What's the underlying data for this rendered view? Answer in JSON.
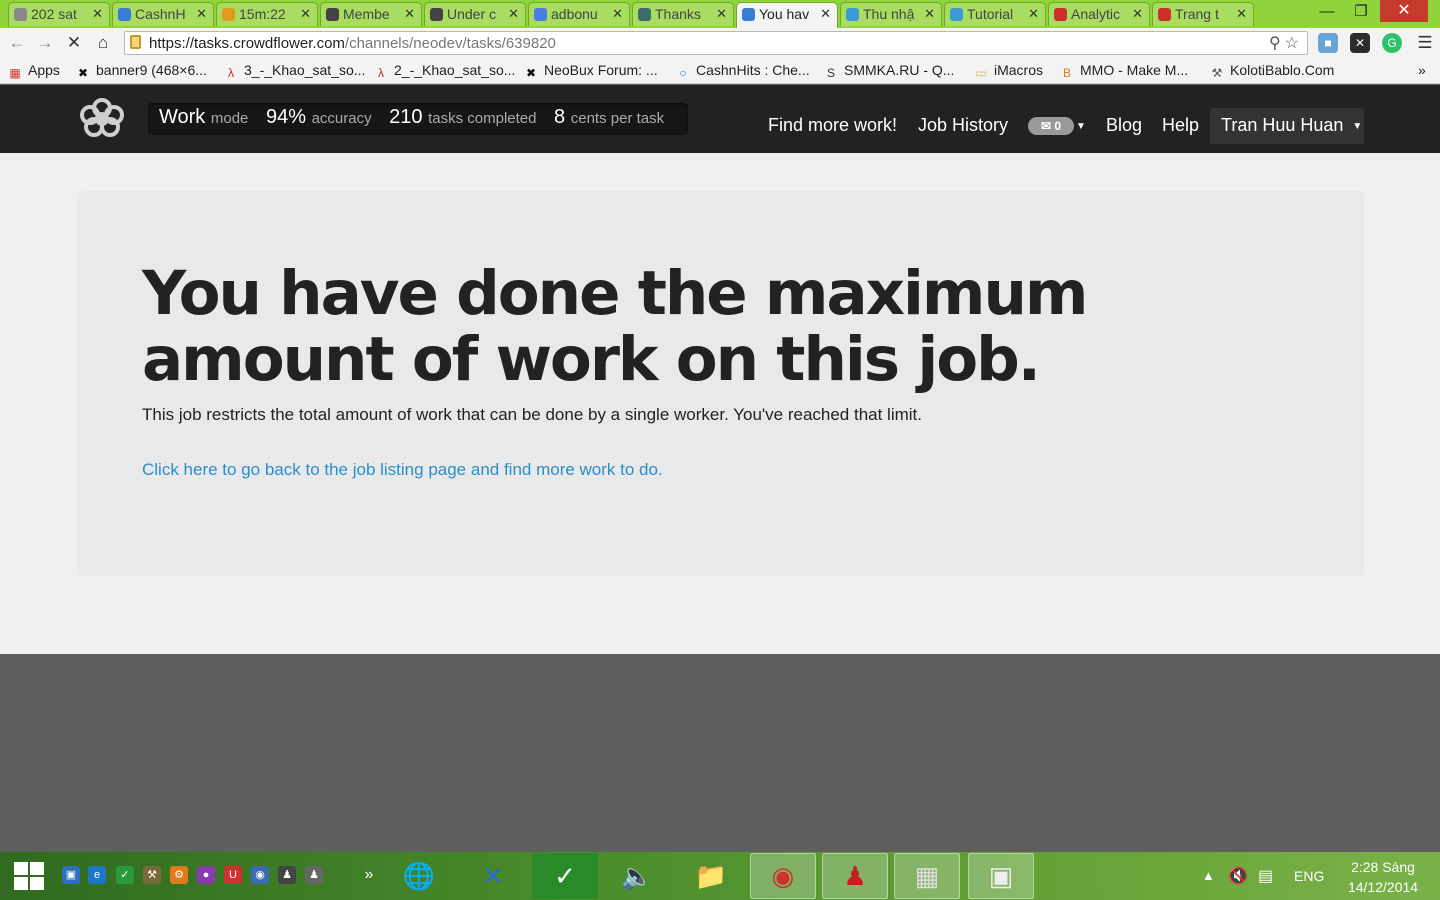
{
  "browser": {
    "tabs": [
      {
        "title": "202 sat",
        "icon": "globe-icon",
        "color": "#8a8a8a"
      },
      {
        "title": "CashnH",
        "icon": "cashnhits-icon",
        "color": "#3a7bd5"
      },
      {
        "title": "15m:22",
        "icon": "bitcoin-icon",
        "color": "#e39a1b"
      },
      {
        "title": "Membe",
        "icon": "neobux-icon",
        "color": "#444444"
      },
      {
        "title": "Under c",
        "icon": "neobux-icon",
        "color": "#444444"
      },
      {
        "title": "adbonu",
        "icon": "google-icon",
        "color": "#4a7fe0"
      },
      {
        "title": "Thanks",
        "icon": "crowdflower-icon",
        "color": "#3c6e6e"
      },
      {
        "title": "You hav",
        "icon": "loading-icon",
        "color": "#3a7bd5"
      },
      {
        "title": "Thu nhậ",
        "icon": "s-icon",
        "color": "#3a9bd5"
      },
      {
        "title": "Tutorial",
        "icon": "s-icon",
        "color": "#3a9bd5"
      },
      {
        "title": "Analytic",
        "icon": "youtube-icon",
        "color": "#d0302a"
      },
      {
        "title": "Trang t",
        "icon": "youtube-icon",
        "color": "#d0302a"
      }
    ],
    "url_host": "https://tasks.crowdflower.com",
    "url_path": "/channels/neodev/tasks/639820",
    "bookmarks": [
      {
        "label": "Apps",
        "icon": "apps-grid-icon"
      },
      {
        "label": "banner9 (468×6...",
        "icon": "x-icon"
      },
      {
        "label": "3_-_Khao_sat_so...",
        "icon": "pdf-icon"
      },
      {
        "label": "2_-_Khao_sat_so...",
        "icon": "pdf-icon"
      },
      {
        "label": "NeoBux Forum: ...",
        "icon": "x-icon"
      },
      {
        "label": "CashnHits : Che...",
        "icon": "cashnhits-icon"
      },
      {
        "label": "SMMKA.RU - Q...",
        "icon": "smmka-icon"
      },
      {
        "label": "iMacros",
        "icon": "folder-icon"
      },
      {
        "label": "MMO - Make M...",
        "icon": "blogger-icon"
      },
      {
        "label": "KolotiBablo.Com",
        "icon": "pickaxe-icon"
      }
    ],
    "bookmarks_overflow": "»"
  },
  "header": {
    "mode_value": "Work",
    "mode_label": "mode",
    "accuracy_value": "94%",
    "accuracy_label": "accuracy",
    "tasks_value": "210",
    "tasks_label": "tasks completed",
    "cents_value": "8",
    "cents_label": "cents per task",
    "nav": {
      "find_work": "Find more work!",
      "job_history": "Job History",
      "inbox_count": "0",
      "blog": "Blog",
      "help": "Help",
      "user": "Tran Huu Huan"
    }
  },
  "main": {
    "headline": "You have done the maximum amount of work on this job.",
    "body": "This job restricts the total amount of work that can be done by a single worker. You've reached that limit.",
    "link": "Click here to go back to the job listing page and find more work to do."
  },
  "taskbar": {
    "show_more": "»",
    "language": "ENG",
    "time": "2:28 Sáng",
    "date": "14/12/2014"
  },
  "colors": {
    "nav_bg": "#222222",
    "link": "#2a8ed0",
    "tab_strip": "#8fd43a"
  }
}
